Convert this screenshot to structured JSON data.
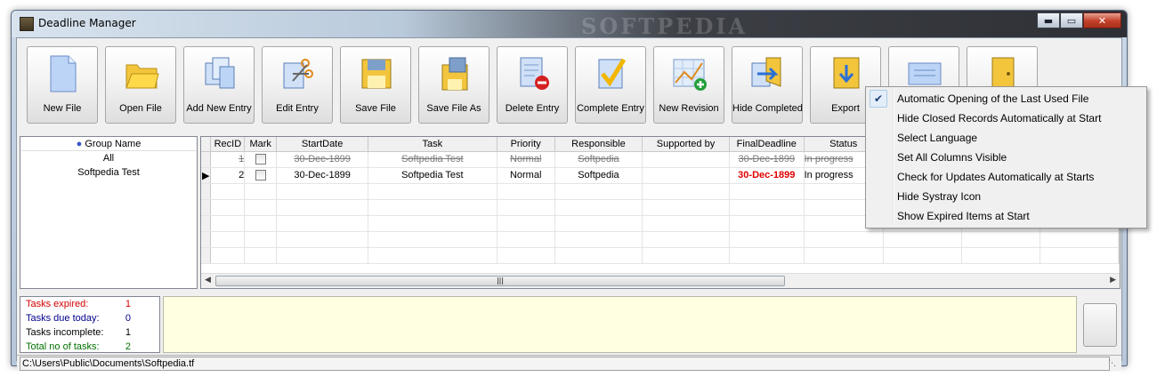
{
  "window": {
    "title": "Deadline Manager",
    "watermark": "SOFTPEDIA"
  },
  "caption": {
    "minimize": "▬",
    "maximize": "▭",
    "close": "✕"
  },
  "toolbar": [
    {
      "label": "New File",
      "icon": "new-file-icon"
    },
    {
      "label": "Open File",
      "icon": "open-folder-icon"
    },
    {
      "label": "Add New Entry",
      "icon": "add-entry-icon"
    },
    {
      "label": "Edit Entry",
      "icon": "edit-entry-icon"
    },
    {
      "label": "Save File",
      "icon": "save-disk-icon"
    },
    {
      "label": "Save File As",
      "icon": "save-as-icon"
    },
    {
      "label": "Delete Entry",
      "icon": "delete-entry-icon"
    },
    {
      "label": "Complete Entry",
      "icon": "complete-check-icon"
    },
    {
      "label": "New Revision",
      "icon": "new-revision-icon"
    },
    {
      "label": "Hide Completed",
      "icon": "hide-completed-icon"
    },
    {
      "label": "Export",
      "icon": "export-icon"
    },
    {
      "label": "",
      "icon": "options-icon"
    },
    {
      "label": "",
      "icon": "exit-door-icon"
    }
  ],
  "groups": {
    "header": "Group Name",
    "items": [
      "All",
      "Softpedia Test"
    ]
  },
  "grid": {
    "columns": [
      "RecID",
      "Mark",
      "StartDate",
      "Task",
      "Priority",
      "Responsible",
      "Supported by",
      "FinalDeadline",
      "Status"
    ],
    "rows": [
      {
        "recid": "1",
        "start": "30-Dec-1899",
        "task": "Softpedia Test",
        "priority": "Normal",
        "responsible": "Softpedia",
        "supported": "",
        "deadline": "30-Dec-1899",
        "status": "In progress",
        "closed": true,
        "current": false
      },
      {
        "recid": "2",
        "start": "30-Dec-1899",
        "task": "Softpedia Test",
        "priority": "Normal",
        "responsible": "Softpedia",
        "supported": "",
        "deadline": "30-Dec-1899",
        "status": "In progress",
        "closed": false,
        "current": true
      }
    ]
  },
  "stats": [
    {
      "label": "Tasks expired:",
      "value": "1",
      "color": "#d00000"
    },
    {
      "label": "Tasks due today:",
      "value": "0",
      "color": "#00008b"
    },
    {
      "label": "Tasks incomplete:",
      "value": "1",
      "color": "#000000"
    },
    {
      "label": "Total no of tasks:",
      "value": "2",
      "color": "#007000"
    }
  ],
  "status_path": "C:\\Users\\Public\\Documents\\Softpedia.tf",
  "menu": {
    "items": [
      {
        "label": "Automatic Opening of the Last Used File",
        "checked": true
      },
      {
        "label": "Hide Closed Records Automatically at Start",
        "checked": false
      },
      {
        "label": "Select Language",
        "checked": false
      },
      {
        "label": "Set All Columns Visible",
        "checked": false
      },
      {
        "label": "Check for Updates Automatically at Starts",
        "checked": false
      },
      {
        "label": "Hide Systray Icon",
        "checked": false
      },
      {
        "label": "Show Expired Items at Start",
        "checked": false
      }
    ]
  }
}
